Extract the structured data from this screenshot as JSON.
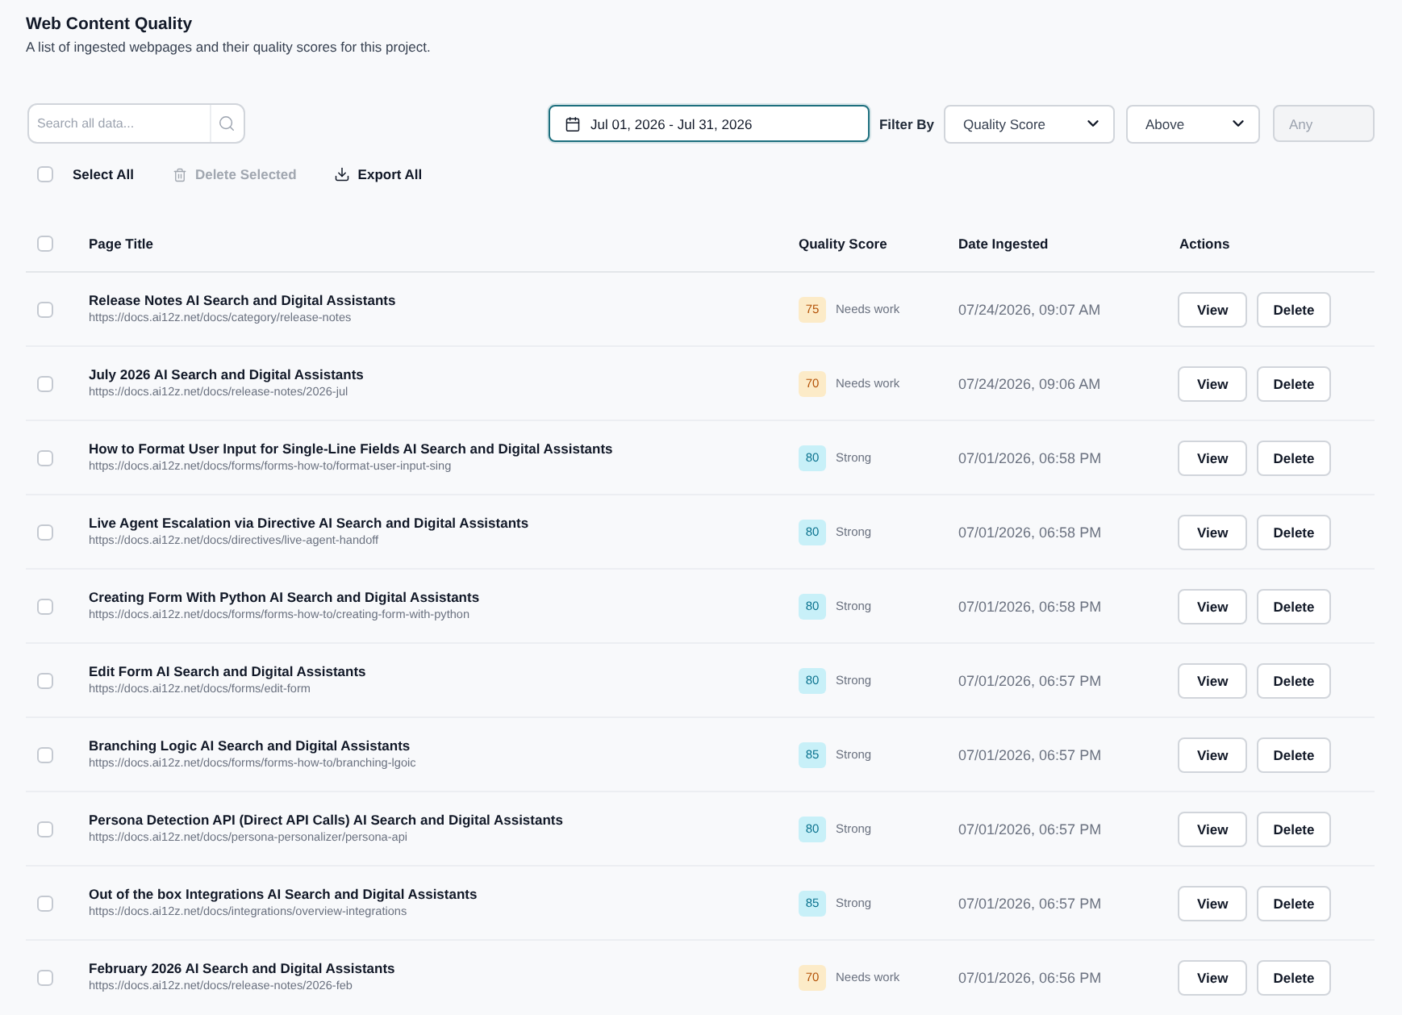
{
  "header": {
    "title": "Web Content Quality",
    "subtitle": "A list of ingested webpages and their quality scores for this project."
  },
  "toolbar": {
    "search": {
      "placeholder": "Search all data..."
    },
    "date_range": {
      "value": "Jul 01, 2026 - Jul 31, 2026",
      "focused": true
    },
    "filter_label": "Filter By",
    "filter_field": {
      "value": "Quality Score"
    },
    "filter_operator": {
      "value": "Above"
    },
    "filter_value": {
      "placeholder": "Any",
      "disabled": true
    }
  },
  "bulk_actions": {
    "select_all": {
      "label": "Select All",
      "checked": false
    },
    "delete_selected": {
      "label": "Delete Selected",
      "disabled": true
    },
    "export_all": {
      "label": "Export All"
    }
  },
  "table": {
    "header_checkbox": {
      "checked": false
    },
    "columns": [
      "Page Title",
      "Quality Score",
      "Date Ingested",
      "Actions"
    ],
    "rows": [
      {
        "checked": false,
        "title": "Release Notes AI Search and Digital Assistants",
        "url": "https://docs.ai12z.net/docs/category/release-notes",
        "score": {
          "value": "75",
          "label": "Needs work",
          "kind": "warning"
        },
        "date": "07/24/2026, 09:07 AM",
        "actions": [
          "View",
          "Delete"
        ]
      },
      {
        "checked": false,
        "title": "July 2026 AI Search and Digital Assistants",
        "url": "https://docs.ai12z.net/docs/release-notes/2026-jul",
        "score": {
          "value": "70",
          "label": "Needs work",
          "kind": "warning"
        },
        "date": "07/24/2026, 09:06 AM",
        "actions": [
          "View",
          "Delete"
        ]
      },
      {
        "checked": false,
        "title": "How to Format User Input for Single-Line Fields AI Search and Digital Assistants",
        "url": "https://docs.ai12z.net/docs/forms/forms-how-to/format-user-input-sing",
        "score": {
          "value": "80",
          "label": "Strong",
          "kind": "good"
        },
        "date": "07/01/2026, 06:58 PM",
        "actions": [
          "View",
          "Delete"
        ]
      },
      {
        "checked": false,
        "title": "Live Agent Escalation via Directive AI Search and Digital Assistants",
        "url": "https://docs.ai12z.net/docs/directives/live-agent-handoff",
        "score": {
          "value": "80",
          "label": "Strong",
          "kind": "good"
        },
        "date": "07/01/2026, 06:58 PM",
        "actions": [
          "View",
          "Delete"
        ]
      },
      {
        "checked": false,
        "title": "Creating Form With Python AI Search and Digital Assistants",
        "url": "https://docs.ai12z.net/docs/forms/forms-how-to/creating-form-with-python",
        "score": {
          "value": "80",
          "label": "Strong",
          "kind": "good"
        },
        "date": "07/01/2026, 06:58 PM",
        "actions": [
          "View",
          "Delete"
        ]
      },
      {
        "checked": false,
        "title": "Edit Form AI Search and Digital Assistants",
        "url": "https://docs.ai12z.net/docs/forms/edit-form",
        "score": {
          "value": "80",
          "label": "Strong",
          "kind": "good"
        },
        "date": "07/01/2026, 06:57 PM",
        "actions": [
          "View",
          "Delete"
        ]
      },
      {
        "checked": false,
        "title": "Branching Logic AI Search and Digital Assistants",
        "url": "https://docs.ai12z.net/docs/forms/forms-how-to/branching-lgoic",
        "score": {
          "value": "85",
          "label": "Strong",
          "kind": "good"
        },
        "date": "07/01/2026, 06:57 PM",
        "actions": [
          "View",
          "Delete"
        ]
      },
      {
        "checked": false,
        "title": "Persona Detection API (Direct API Calls) AI Search and Digital Assistants",
        "url": "https://docs.ai12z.net/docs/persona-personalizer/persona-api",
        "score": {
          "value": "80",
          "label": "Strong",
          "kind": "good"
        },
        "date": "07/01/2026, 06:57 PM",
        "actions": [
          "View",
          "Delete"
        ]
      },
      {
        "checked": false,
        "title": "Out of the box Integrations AI Search and Digital Assistants",
        "url": "https://docs.ai12z.net/docs/integrations/overview-integrations",
        "score": {
          "value": "85",
          "label": "Strong",
          "kind": "good"
        },
        "date": "07/01/2026, 06:57 PM",
        "actions": [
          "View",
          "Delete"
        ]
      },
      {
        "checked": false,
        "title": "February 2026 AI Search and Digital Assistants",
        "url": "https://docs.ai12z.net/docs/release-notes/2026-feb",
        "score": {
          "value": "70",
          "label": "Needs work",
          "kind": "warning"
        },
        "date": "07/01/2026, 06:56 PM",
        "actions": [
          "View",
          "Delete"
        ]
      }
    ]
  }
}
